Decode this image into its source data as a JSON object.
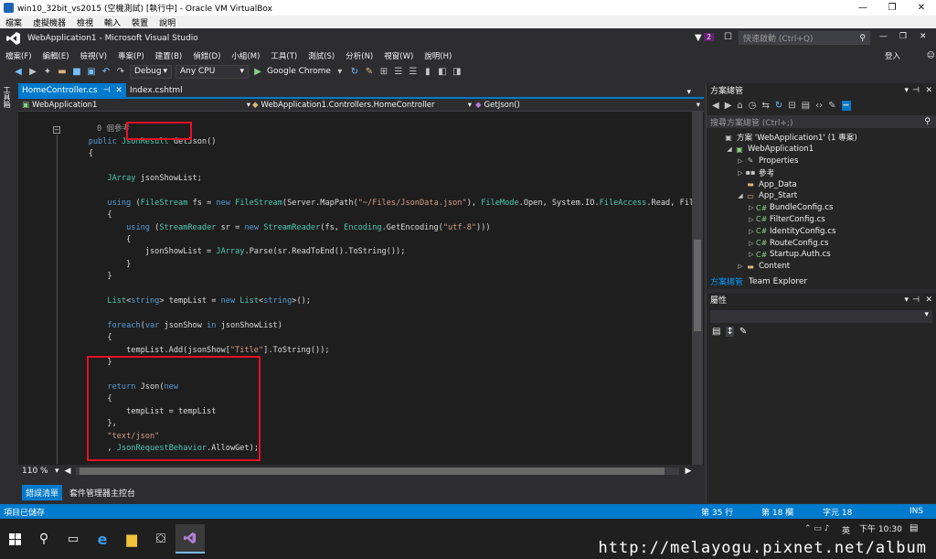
{
  "vbox": {
    "title": "win10_32bit_vs2015 (空機測試) [執行中] - Oracle VM VirtualBox",
    "menu": [
      "檔案",
      "虛擬機器",
      "檢視",
      "輸入",
      "裝置",
      "說明"
    ]
  },
  "vs": {
    "title": "WebApplication1 - Microsoft Visual Studio",
    "notif_count": "2",
    "quick_launch": "快速啟動 (Ctrl+Q)",
    "signin": "登入",
    "menu": [
      "檔案(F)",
      "編輯(E)",
      "檢視(V)",
      "專案(P)",
      "建置(B)",
      "偵錯(D)",
      "小組(M)",
      "工具(T)",
      "測試(S)",
      "分析(N)",
      "視窗(W)",
      "說明(H)"
    ],
    "config": "Debug",
    "platform": "Any CPU",
    "browser": "Google Chrome"
  },
  "tabs": [
    {
      "label": "HomeController.cs"
    },
    {
      "label": "Index.cshtml"
    }
  ],
  "nav": {
    "project": "WebApplication1",
    "class": "WebApplication1.Controllers.HomeController",
    "member": "GetJson()"
  },
  "code": {
    "refs": "0 個參考"
  },
  "zoom": "110 %",
  "output_tabs": [
    "錯誤清單",
    "套件管理器主控台"
  ],
  "status": {
    "message": "項目已儲存",
    "line": "第 35 行",
    "col": "第 18 欄",
    "char": "字元 18",
    "mode": "INS"
  },
  "left_strip": "工具箱",
  "solution_explorer": {
    "title": "方案總管",
    "search": "搜尋方案總管 (Ctrl+;)",
    "items": [
      {
        "label": "方案 'WebApplication1' (1 專案)",
        "indent": 0,
        "arrow": "",
        "icon": "solution-icon"
      },
      {
        "label": "WebApplication1",
        "indent": 1,
        "arrow": "◢",
        "icon": "project-icon"
      },
      {
        "label": "Properties",
        "indent": 2,
        "arrow": "▷",
        "icon": "wrench-icon"
      },
      {
        "label": "參考",
        "indent": 2,
        "arrow": "▷",
        "icon": "references-icon"
      },
      {
        "label": "App_Data",
        "indent": 2,
        "arrow": "",
        "icon": "folder-icon"
      },
      {
        "label": "App_Start",
        "indent": 2,
        "arrow": "◢",
        "icon": "folder-open-icon"
      },
      {
        "label": "BundleConfig.cs",
        "indent": 3,
        "arrow": "▷",
        "icon": "cs-file-icon"
      },
      {
        "label": "FilterConfig.cs",
        "indent": 3,
        "arrow": "▷",
        "icon": "cs-file-icon"
      },
      {
        "label": "IdentityConfig.cs",
        "indent": 3,
        "arrow": "▷",
        "icon": "cs-file-icon"
      },
      {
        "label": "RouteConfig.cs",
        "indent": 3,
        "arrow": "▷",
        "icon": "cs-file-icon"
      },
      {
        "label": "Startup.Auth.cs",
        "indent": 3,
        "arrow": "▷",
        "icon": "cs-file-icon"
      },
      {
        "label": "Content",
        "indent": 2,
        "arrow": "▷",
        "icon": "folder-icon"
      }
    ],
    "tab1": "方案總管",
    "tab2": "Team Explorer"
  },
  "properties": {
    "title": "屬性"
  },
  "taskbar": {
    "time": "下午 10:30",
    "lang": "英"
  },
  "watermark": "http://melayogu.pixnet.net/album",
  "colors": {
    "accent": "#007acc",
    "highlight": "#e81123"
  }
}
